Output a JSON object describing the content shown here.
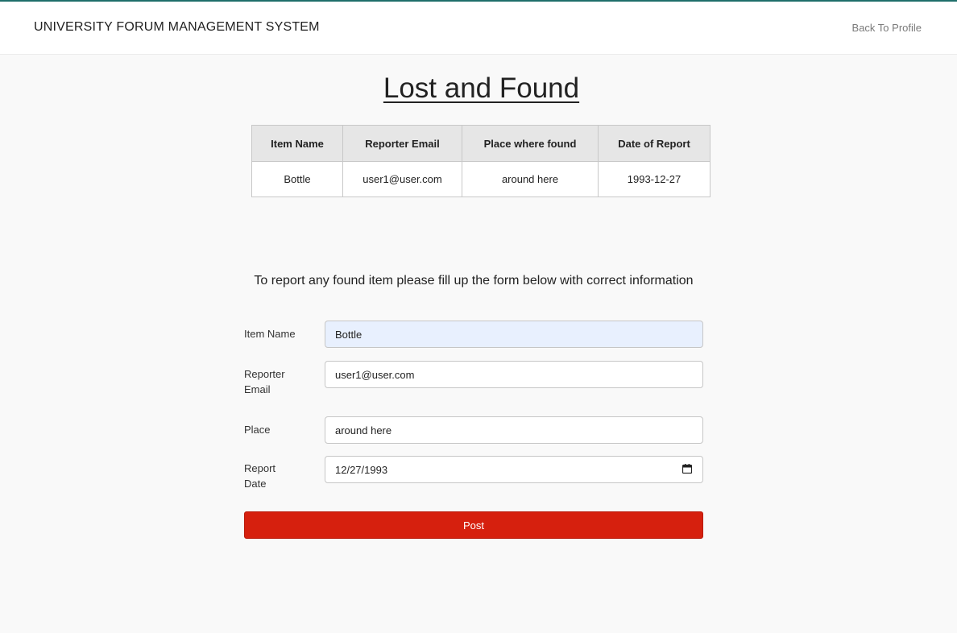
{
  "nav": {
    "brand": "UNIVERSITY FORUM MANAGEMENT SYSTEM",
    "back_link": "Back To Profile"
  },
  "page": {
    "title": "Lost and Found"
  },
  "table": {
    "headers": [
      "Item Name",
      "Reporter Email",
      "Place where found",
      "Date of Report"
    ],
    "rows": [
      [
        "Bottle",
        "user1@user.com",
        "around here",
        "1993-12-27"
      ]
    ]
  },
  "form": {
    "intro": "To report any found item please fill up the form below with correct information",
    "item_name": {
      "label": "Item Name",
      "value": "Bottle"
    },
    "reporter_email": {
      "label": "Reporter Email",
      "value": "user1@user.com"
    },
    "place": {
      "label": "Place",
      "value": "around here"
    },
    "report_date": {
      "label": "Report Date",
      "value": "12/27/1993"
    },
    "submit_label": "Post"
  },
  "colors": {
    "accent": "#1e6e6a",
    "button": "#d6200e",
    "autofill": "#e8f0fe"
  }
}
